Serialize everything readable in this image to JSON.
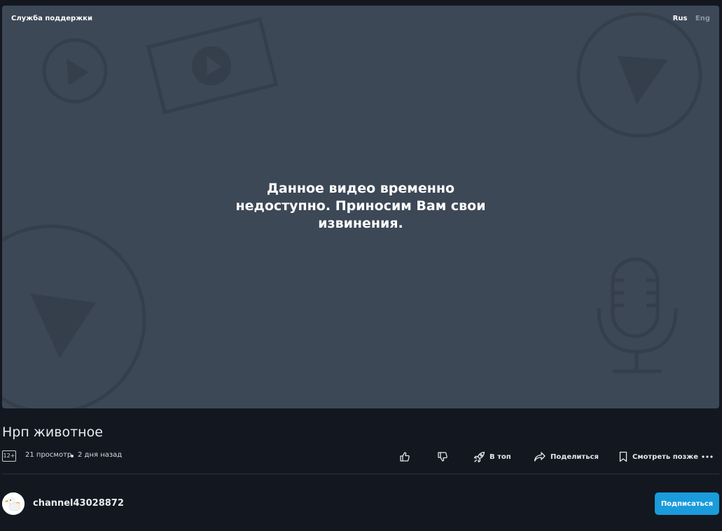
{
  "player": {
    "support_link": "Служба поддержки",
    "languages": [
      {
        "label": "Rus",
        "active": true
      },
      {
        "label": "Eng",
        "active": false
      }
    ],
    "unavailable_message": "Данное видео временно недоступно. Приносим Вам свои извинения.",
    "background_color": "#3d4856",
    "decor_color": "#353f4b"
  },
  "video": {
    "title": "Нрп животное",
    "age_rating": "12+",
    "views": "21 просмотр",
    "published": "2 дня назад"
  },
  "actions": {
    "like_icon": "thumbs-up-icon",
    "dislike_icon": "thumbs-down-icon",
    "boost_label": "В топ",
    "boost_icon": "rocket-icon",
    "share_label": "Поделиться",
    "share_icon": "share-arrow-icon",
    "watch_later_label": "Смотреть позже",
    "watch_later_icon": "bookmark-icon",
    "more_icon": "more-dots-icon"
  },
  "channel": {
    "name": "channel43028872",
    "subscribe_label": "Подписаться",
    "subscribe_color": "#1a9bdb"
  }
}
